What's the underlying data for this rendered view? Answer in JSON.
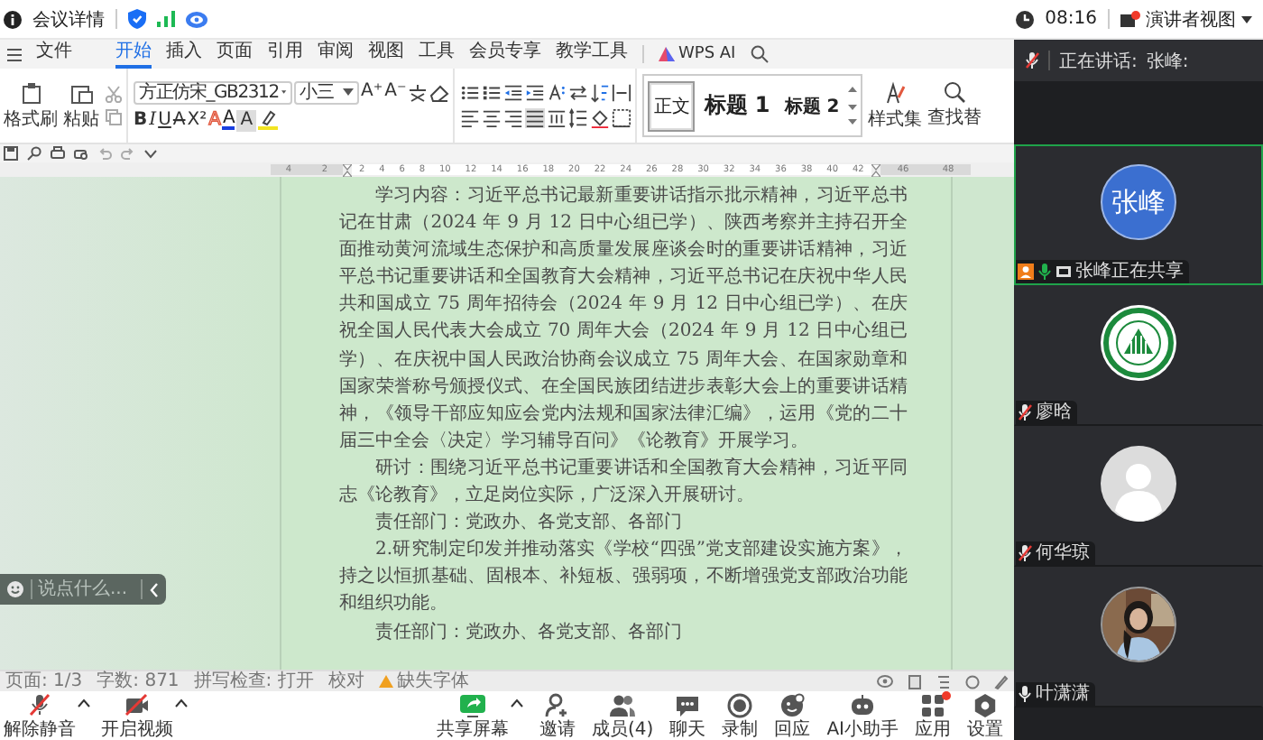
{
  "top_bar": {
    "title": "会议详情",
    "time": "08:16",
    "view_button": "演讲者视图"
  },
  "menu": {
    "file": "文件",
    "tabs": [
      {
        "label": "开始",
        "selected": true
      },
      {
        "label": "插入",
        "selected": false
      },
      {
        "label": "页面",
        "selected": false
      },
      {
        "label": "引用",
        "selected": false
      },
      {
        "label": "审阅",
        "selected": false
      },
      {
        "label": "视图",
        "selected": false
      },
      {
        "label": "工具",
        "selected": false
      },
      {
        "label": "会员专享",
        "selected": false
      },
      {
        "label": "教学工具",
        "selected": false
      }
    ],
    "ai": "WPS AI"
  },
  "ribbon": {
    "format_painter": "格式刷",
    "paste": "粘贴",
    "font": "方正仿宋_GB2312",
    "size": "小三",
    "size_buttons": [
      "A⁺",
      "A⁻"
    ],
    "text_buttons": [
      {
        "label": "B",
        "kind": "bold"
      },
      {
        "label": "I",
        "kind": "italic"
      },
      {
        "label": "U",
        "kind": "underline"
      },
      {
        "label": "A",
        "kind": "strike"
      },
      {
        "label": "X²",
        "kind": "super"
      },
      {
        "label": "A",
        "kind": "effect"
      },
      {
        "label": "A",
        "kind": "color"
      },
      {
        "label": "A",
        "kind": "shade"
      }
    ],
    "paragraph_buttons": [
      {
        "kind": "bullets",
        "selected": false
      },
      {
        "kind": "numbers",
        "selected": false
      },
      {
        "kind": "outdent",
        "selected": false
      },
      {
        "kind": "indent",
        "selected": false
      },
      {
        "kind": "direction",
        "selected": false
      },
      {
        "kind": "swap",
        "selected": false
      },
      {
        "kind": "sort",
        "selected": false
      },
      {
        "kind": "marks",
        "selected": false
      },
      {
        "kind": "left",
        "selected": false
      },
      {
        "kind": "center",
        "selected": false
      },
      {
        "kind": "right",
        "selected": false
      },
      {
        "kind": "justify",
        "selected": true
      },
      {
        "kind": "distribute",
        "selected": false
      },
      {
        "kind": "spacing",
        "selected": false
      },
      {
        "kind": "shading",
        "selected": false
      },
      {
        "kind": "border",
        "selected": false
      }
    ],
    "styles": [
      {
        "label": "正文",
        "kind": "normal",
        "selected": true
      },
      {
        "label": "标题 1",
        "kind": "h1",
        "selected": false
      },
      {
        "label": "标题 2",
        "kind": "h2",
        "selected": false
      }
    ],
    "style_set": "样式集",
    "find": "查找替"
  },
  "ruler": {
    "left_marks": [
      "4",
      "2"
    ],
    "marks": [
      "2",
      "4",
      "6",
      "8",
      "10",
      "12",
      "14",
      "16",
      "18",
      "20",
      "22",
      "24",
      "26",
      "28",
      "30",
      "32",
      "34",
      "36",
      "38",
      "40",
      "42"
    ],
    "right_marks": [
      "46",
      "48"
    ]
  },
  "document": {
    "paragraphs": [
      "学习内容：习近平总书记最新重要讲话指示批示精神，习近平总书记在甘肃（2024 年 9 月 12 日中心组已学）、陕西考察并主持召开全面推动黄河流域生态保护和高质量发展座谈会时的重要讲话精神，习近平总书记重要讲话和全国教育大会精神，习近平总书记在庆祝中华人民共和国成立 75 周年招待会（2024 年 9 月 12 日中心组已学）、在庆祝全国人民代表大会成立 70 周年大会（2024 年 9 月 12 日中心组已学）、在庆祝中国人民政治协商会议成立 75 周年大会、在国家勋章和国家荣誉称号颁授仪式、在全国民族团结进步表彰大会上的重要讲话精神，《领导干部应知应会党内法规和国家法律汇编》，运用《党的二十届三中全会〈决定〉学习辅导百问》《论教育》开展学习。",
      "研讨：围绕习近平总书记重要讲话和全国教育大会精神，习近平同志《论教育》，立足岗位实际，广泛深入开展研讨。",
      "责任部门：党政办、各党支部、各部门",
      "2.研究制定印发并推动落实《学校“四强”党支部建设实施方案》，持之以恒抓基础、固根本、补短板、强弱项，不断增强党支部政治功能和组织功能。",
      "责任部门：党政办、各党支部、各部门"
    ]
  },
  "chat": {
    "placeholder": "说点什么..."
  },
  "status_bar": [
    "页面: 1/3",
    "字数: 871",
    "拼写检查: 打开",
    "校对",
    "缺失字体"
  ],
  "panel": {
    "speaking_label": "正在讲话:",
    "speaker": "张峰:",
    "participants": [
      {
        "name": "张峰正在共享",
        "kind": "initials",
        "initials": "张峰",
        "active": true,
        "sharing": true,
        "muted": false,
        "talking": true
      },
      {
        "name": "廖晗",
        "kind": "logo",
        "active": false,
        "sharing": false,
        "muted": true,
        "talking": false
      },
      {
        "name": "何华琼",
        "kind": "silhouette",
        "active": false,
        "sharing": false,
        "muted": true,
        "talking": false
      },
      {
        "name": "叶潇潇",
        "kind": "picture",
        "active": false,
        "sharing": false,
        "muted": false,
        "talking": false
      }
    ]
  },
  "toolbar": {
    "left": [
      {
        "label": "解除静音",
        "kind": "mic-off",
        "menu": true
      },
      {
        "label": "开启视频",
        "kind": "video-off",
        "menu": true
      }
    ],
    "center": [
      {
        "label": "共享屏幕",
        "kind": "share",
        "menu": true,
        "badge": false
      },
      {
        "label": "邀请",
        "kind": "invite",
        "menu": false,
        "badge": false
      },
      {
        "label": "成员(4)",
        "kind": "members",
        "menu": false,
        "badge": false
      },
      {
        "label": "聊天",
        "kind": "chat",
        "menu": false,
        "badge": false
      },
      {
        "label": "录制",
        "kind": "record",
        "menu": false,
        "badge": false
      },
      {
        "label": "回应",
        "kind": "reaction",
        "menu": false,
        "badge": false
      },
      {
        "label": "AI小助手",
        "kind": "ai",
        "menu": false,
        "badge": false
      },
      {
        "label": "应用",
        "kind": "apps",
        "menu": false,
        "badge": true
      },
      {
        "label": "设置",
        "kind": "settings",
        "menu": false,
        "badge": false
      }
    ]
  }
}
